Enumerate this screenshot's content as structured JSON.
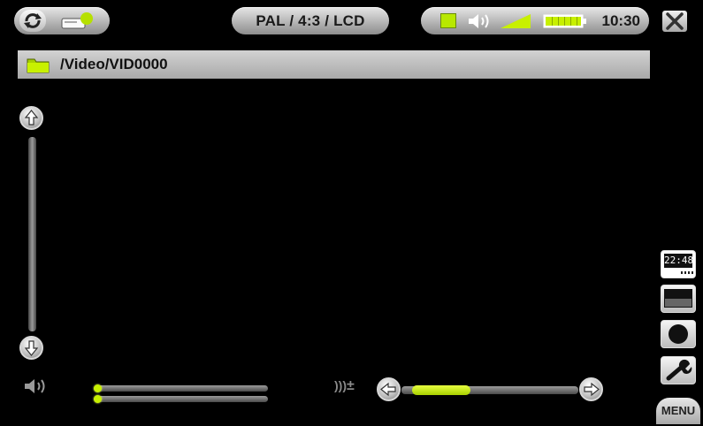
{
  "status_bar": {
    "mode": "PAL / 4:3 / LCD",
    "time": "10:30",
    "icons": [
      "refresh-icon",
      "hdd-icon",
      "playback-square-icon",
      "speaker-icon",
      "signal-icon",
      "battery-icon",
      "close-icon"
    ]
  },
  "path_bar": {
    "path": "/Video/VID0000",
    "icon": "folder-icon"
  },
  "right_toolbar": {
    "clock_label": "22:48",
    "menu_label": "MENU",
    "icons": [
      "clock-icon",
      "screen-icon",
      "record-icon",
      "wrench-icon"
    ]
  },
  "volume": {
    "icon": "speaker-icon",
    "level": 0.0
  },
  "audio_offset": {
    "icon": "audio-offset-icon",
    "symbol": "±",
    "level": 0.36
  },
  "colors": {
    "accent": "#c8f000",
    "bar_gray": "#b5b5b5",
    "background": "#000000"
  }
}
